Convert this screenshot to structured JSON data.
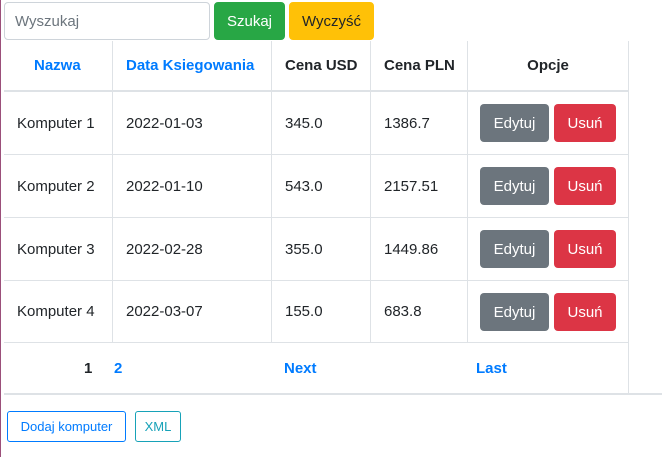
{
  "search": {
    "placeholder": "Wyszukaj",
    "value": ""
  },
  "toolbar": {
    "search_label": "Szukaj",
    "clear_label": "Wyczyść"
  },
  "table": {
    "headers": [
      "Nazwa",
      "Data Ksiegowania",
      "Cena USD",
      "Cena PLN",
      "Opcje"
    ],
    "rows": [
      {
        "name": "Komputer 1",
        "date": "2022-01-03",
        "usd": "345.0",
        "pln": "1386.7"
      },
      {
        "name": "Komputer 2",
        "date": "2022-01-10",
        "usd": "543.0",
        "pln": "2157.51"
      },
      {
        "name": "Komputer 3",
        "date": "2022-02-28",
        "usd": "355.0",
        "pln": "1449.86"
      },
      {
        "name": "Komputer 4",
        "date": "2022-03-07",
        "usd": "155.0",
        "pln": "683.8"
      }
    ],
    "edit_label": "Edytuj",
    "delete_label": "Usuń"
  },
  "pagination": {
    "page1": "1",
    "page2": "2",
    "next": "Next",
    "last": "Last"
  },
  "footer": {
    "add_label": "Dodaj komputer",
    "xml_label": "XML"
  },
  "colors": {
    "link": "#007bff",
    "success": "#28a745",
    "warning": "#ffc107",
    "secondary": "#6c757d",
    "danger": "#dc3545",
    "info": "#17a2b8"
  }
}
